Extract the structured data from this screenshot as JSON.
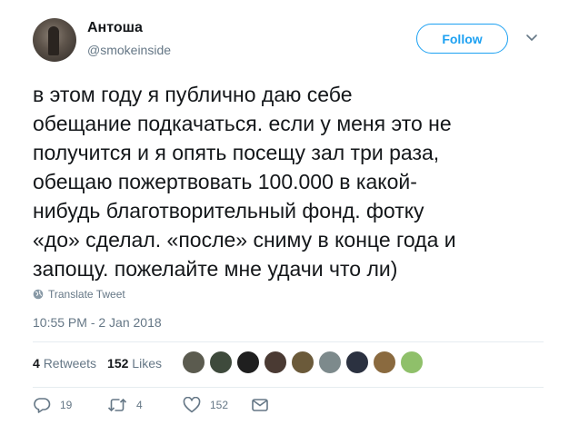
{
  "user": {
    "name": "Антоша",
    "handle": "@smokeinside"
  },
  "follow_button": {
    "label": "Follow"
  },
  "tweet": {
    "text": "в этом году я публично даю себе\nобещание подкачаться. если у меня это не\nполучится и я опять посещу зал три раза,\nобещаю пожертвовать 100.000 в какой-\nнибудь благотворительный фонд. фотку\n«до» сделал. «после» сниму в конце года и\nзапощу. пожелайте мне удачи что ли)",
    "translate_label": "Translate Tweet",
    "timestamp": "10:55 PM - 2 Jan 2018"
  },
  "stats": {
    "retweets_count": "4",
    "retweets_label": "Retweets",
    "likes_count": "152",
    "likes_label": "Likes"
  },
  "likers": [
    {
      "color": "#5b5b4f"
    },
    {
      "color": "#3e4a3c"
    },
    {
      "color": "#1f1f1f"
    },
    {
      "color": "#4a3a33"
    },
    {
      "color": "#6b5a3a"
    },
    {
      "color": "#7d8a8c"
    },
    {
      "color": "#2b3140"
    },
    {
      "color": "#8a6a3f"
    },
    {
      "color": "#8fc06a"
    }
  ],
  "actions": {
    "reply_count": "19",
    "retweet_count": "4",
    "like_count": "152"
  },
  "icons": [
    "globe-icon",
    "reply-icon",
    "retweet-icon",
    "heart-icon",
    "message-icon",
    "chevron-down-icon"
  ]
}
